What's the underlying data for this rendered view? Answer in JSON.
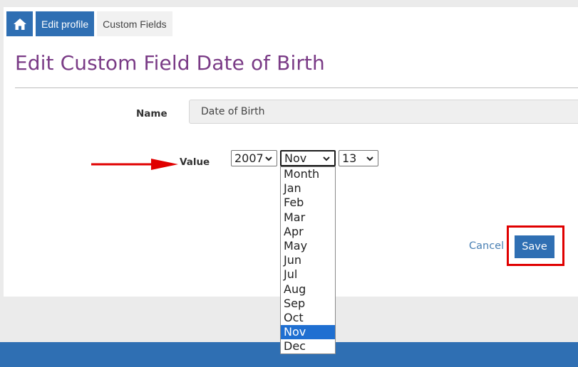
{
  "breadcrumbs": {
    "home_icon": "home-icon",
    "items": [
      {
        "label": "Edit profile"
      },
      {
        "label": "Custom Fields"
      }
    ]
  },
  "page": {
    "title": "Edit Custom Field Date of Birth"
  },
  "form": {
    "name_label": "Name",
    "name_value": "Date of Birth",
    "value_label": "Value",
    "year_value": "2007",
    "month_value": "Nov",
    "day_value": "13",
    "month_options": [
      "Month",
      "Jan",
      "Feb",
      "Mar",
      "Apr",
      "May",
      "Jun",
      "Jul",
      "Aug",
      "Sep",
      "Oct",
      "Nov",
      "Dec"
    ],
    "selected_month_index": 11
  },
  "actions": {
    "cancel_label": "Cancel",
    "save_label": "Save"
  },
  "colors": {
    "brand_blue": "#2f6fb3",
    "title_purple": "#7a3b86",
    "highlight_red": "#e00000",
    "dropdown_selected": "#1f6fd1"
  }
}
